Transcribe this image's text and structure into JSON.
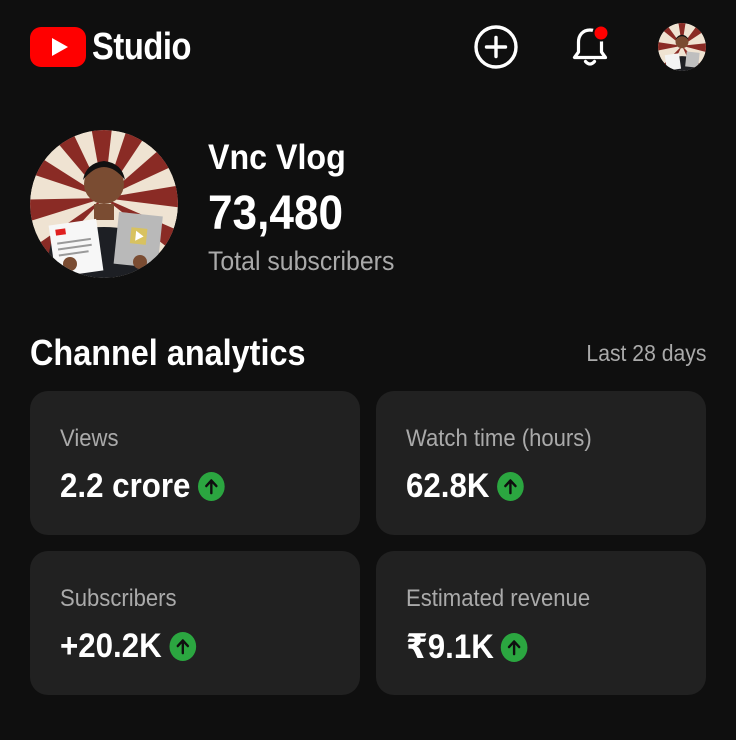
{
  "app": {
    "logo_text": "Studio",
    "brand_color": "#ff0000"
  },
  "topbar": {
    "icons": [
      "create-icon",
      "notifications-bell-icon",
      "account-avatar"
    ],
    "has_unread_notifications": true,
    "notification_dot_color": "#ff0000"
  },
  "channel": {
    "name": "Vnc Vlog",
    "subscriber_count": "73,480",
    "subscriber_label": "Total subscribers"
  },
  "analytics": {
    "title": "Channel analytics",
    "period": "Last 28 days",
    "trend_color": "#2ba640",
    "cards": [
      {
        "label": "Views",
        "value": "2.2 crore",
        "trend": "up"
      },
      {
        "label": "Watch time (hours)",
        "value": "62.8K",
        "trend": "up"
      },
      {
        "label": "Subscribers",
        "value": "+20.2K",
        "trend": "up"
      },
      {
        "label": "Estimated revenue",
        "value": "₹9.1K",
        "trend": "up"
      }
    ]
  }
}
